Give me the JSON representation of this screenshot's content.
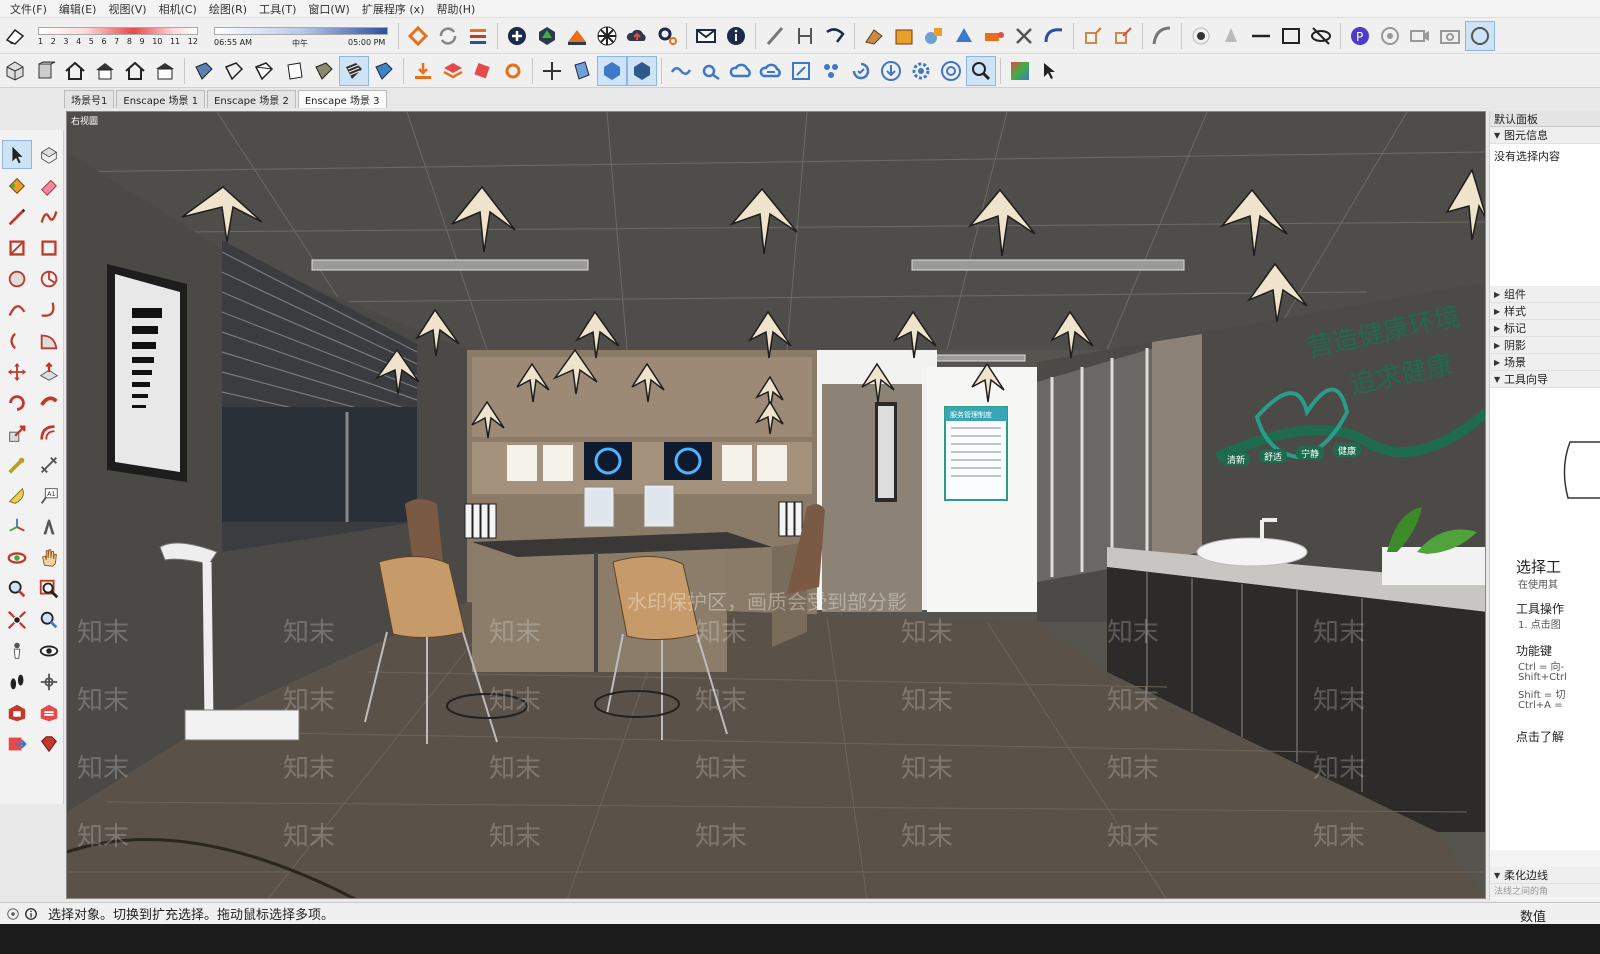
{
  "menu": [
    "文件(F)",
    "编辑(E)",
    "视图(V)",
    "相机(C)",
    "绘图(R)",
    "工具(T)",
    "窗口(W)",
    "扩展程序 (x)",
    "帮助(H)"
  ],
  "shadow": {
    "months": [
      "1",
      "2",
      "3",
      "4",
      "5",
      "6",
      "7",
      "8",
      "9",
      "10",
      "11",
      "12"
    ],
    "time_start": "06:55 AM",
    "time_mid": "中午",
    "time_end": "05:00 PM"
  },
  "scene_tabs": [
    "场景号1",
    "Enscape 场景 1",
    "Enscape 场景 2",
    "Enscape 场景 3"
  ],
  "viewport": {
    "label": "右视圖",
    "wall_slogan_line1": "营造健康环境",
    "wall_slogan_line2": "追求健康",
    "wall_tags": [
      "清新",
      "舒适",
      "宁静",
      "健康"
    ],
    "poster_title": "服务管理制度",
    "watermark_banner": "水印保护区，画质会受到部分影",
    "watermark_text": "知末"
  },
  "tray": {
    "title": "默认面板",
    "entity_info": "图元信息",
    "entity_info_body": "没有选择内容",
    "sections": [
      "组件",
      "样式",
      "标记",
      "阴影",
      "场景"
    ],
    "tools_guide": "工具向导",
    "guide_title": "选择工",
    "guide_sub": "在使用其",
    "guide_op_head": "工具操作",
    "guide_op_line": "1. 点击图",
    "guide_keys_head": "功能键",
    "guide_keys": [
      "Ctrl = 向-",
      "Shift+Ctrl",
      "Shift = 切",
      "Ctrl+A = "
    ],
    "guide_more": "点击了解",
    "soften_edges": "柔化边线",
    "soften_sub": "法线之间的角"
  },
  "status": {
    "text": "选择对象。切换到扩充选择。拖动鼠标选择多项。",
    "measure_label": "数值"
  },
  "colors": {
    "accent_green": "#1f6b4f",
    "accent_blue": "#2b4fa1",
    "toolbar_orange": "#e8701a"
  }
}
